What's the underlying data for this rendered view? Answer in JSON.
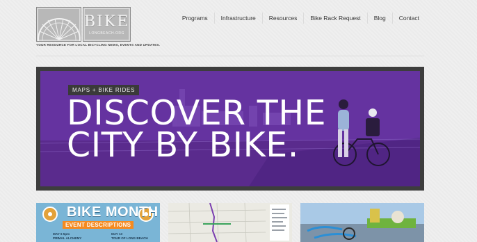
{
  "logo": {
    "wordmark": "BIKE",
    "subtext": "LONGBEACH.ORG",
    "tagline": "YOUR RESOURCE FOR LOCAL BICYCLING NEWS, EVENTS AND UPDATES."
  },
  "nav": {
    "items": [
      {
        "label": "Programs"
      },
      {
        "label": "Infrastructure"
      },
      {
        "label": "Resources"
      },
      {
        "label": "Bike Rack Request"
      },
      {
        "label": "Blog"
      },
      {
        "label": "Contact"
      }
    ]
  },
  "hero": {
    "badge": "MAPS + BIKE RIDES",
    "title_line1": "DISCOVER THE",
    "title_line2": "CITY BY BIKE."
  },
  "thumbs": {
    "bike_month": {
      "title": "BIKE MONTH",
      "bar": "EVENT DESCRIPTIONS",
      "date1_line1": "MAY 6 5pm",
      "date1_line2": "PRIMAL ALCHEMY",
      "date2_line1": "MAY 13",
      "date2_line2": "TOUR OF LONG BEACH"
    }
  },
  "colors": {
    "hero_purple": "#6a38a3",
    "frame": "#3d3d3d",
    "accent_orange": "#f58a1f",
    "thumb_blue": "#7ab5d6"
  }
}
